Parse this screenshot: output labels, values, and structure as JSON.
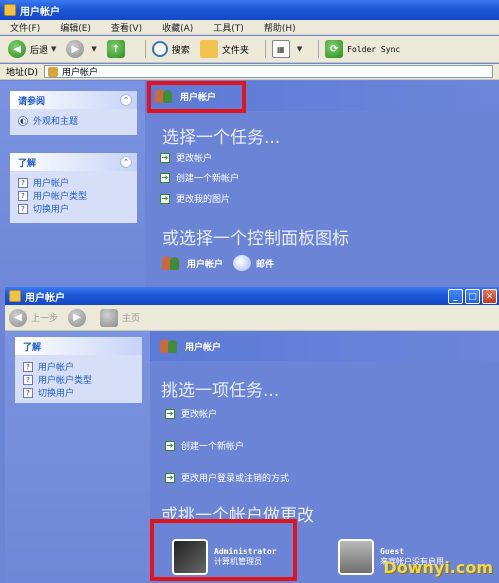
{
  "win1": {
    "title": "用户帐户",
    "menu": [
      "文件(F)",
      "编辑(E)",
      "查看(V)",
      "收藏(A)",
      "工具(T)",
      "帮助(H)"
    ],
    "toolbar": {
      "back": "后退",
      "search": "搜索",
      "folders": "文件夹",
      "folder_sync": "Folder Sync"
    },
    "address": {
      "label": "地址(D)",
      "value": "用户帐户"
    },
    "see_also": {
      "title": "请参阅",
      "items": [
        "外观和主题"
      ]
    },
    "learn": {
      "title": "了解",
      "items": [
        "用户帐户",
        "用户帐户类型",
        "切换用户"
      ]
    },
    "header": "用户帐户",
    "pick_task": "选择一个任务...",
    "tasks": [
      "更改帐户",
      "创建一个新帐户",
      "更改我的图片"
    ],
    "pick_icon": "或选择一个控制面板图标",
    "icons": [
      "用户帐户",
      "邮件"
    ]
  },
  "win2": {
    "title": "用户帐户",
    "toolbar": {
      "back": "上一步",
      "home": "主页"
    },
    "learn": {
      "title": "了解",
      "items": [
        "用户帐户",
        "用户帐户类型",
        "切换用户"
      ]
    },
    "header": "用户帐户",
    "pick_task": "挑选一项任务...",
    "tasks": [
      "更改帐户",
      "创建一个新帐户",
      "更改用户登录或注销的方式"
    ],
    "pick_account": "或挑一个帐户做更改",
    "accounts": [
      {
        "name": "Administrator",
        "role": "计算机管理员"
      },
      {
        "name": "Guest",
        "role": "来宾帐户没有启用"
      }
    ],
    "watermark": "Downyi.com"
  },
  "colors": {
    "highlight": "#e1141e",
    "xp_blue": "#6b84d6"
  }
}
